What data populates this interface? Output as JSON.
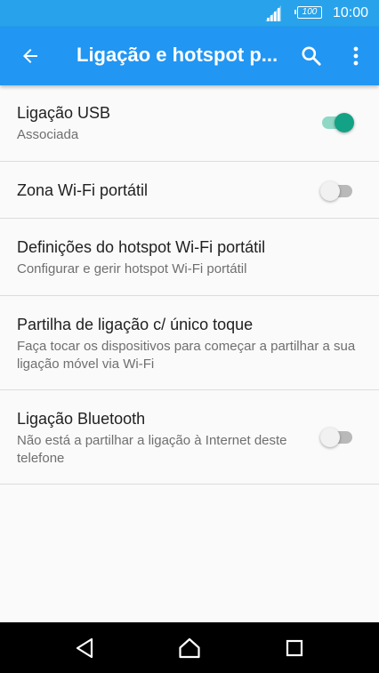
{
  "status_bar": {
    "battery": "100",
    "time": "10:00",
    "icons": [
      "signal-icon",
      "battery-icon"
    ]
  },
  "app_bar": {
    "title": "Ligação e hotspot p...",
    "icons": [
      "back-arrow-icon",
      "search-icon",
      "more-vert-icon"
    ]
  },
  "settings": [
    {
      "title": "Ligação USB",
      "subtitle": "Associada",
      "toggle": true
    },
    {
      "title": "Zona Wi-Fi portátil",
      "toggle": false
    },
    {
      "title": "Definições do hotspot Wi-Fi portátil",
      "subtitle": "Configurar e gerir hotspot Wi-Fi portátil"
    },
    {
      "title": "Partilha de ligação c/ único toque",
      "subtitle": "Faça tocar os dispositivos para começar a partilhar a sua ligação móvel via Wi-Fi"
    },
    {
      "title": "Ligação Bluetooth",
      "subtitle": "Não está a partilhar a ligação à Internet deste telefone",
      "toggle": false
    }
  ],
  "nav_bar": {
    "icons": [
      "back-triangle-icon",
      "home-icon",
      "recents-icon"
    ]
  },
  "colors": {
    "status_bar": "#28a3eb",
    "app_bar": "#2196f3",
    "switch_on": "#13a286",
    "background": "#fafafa"
  }
}
